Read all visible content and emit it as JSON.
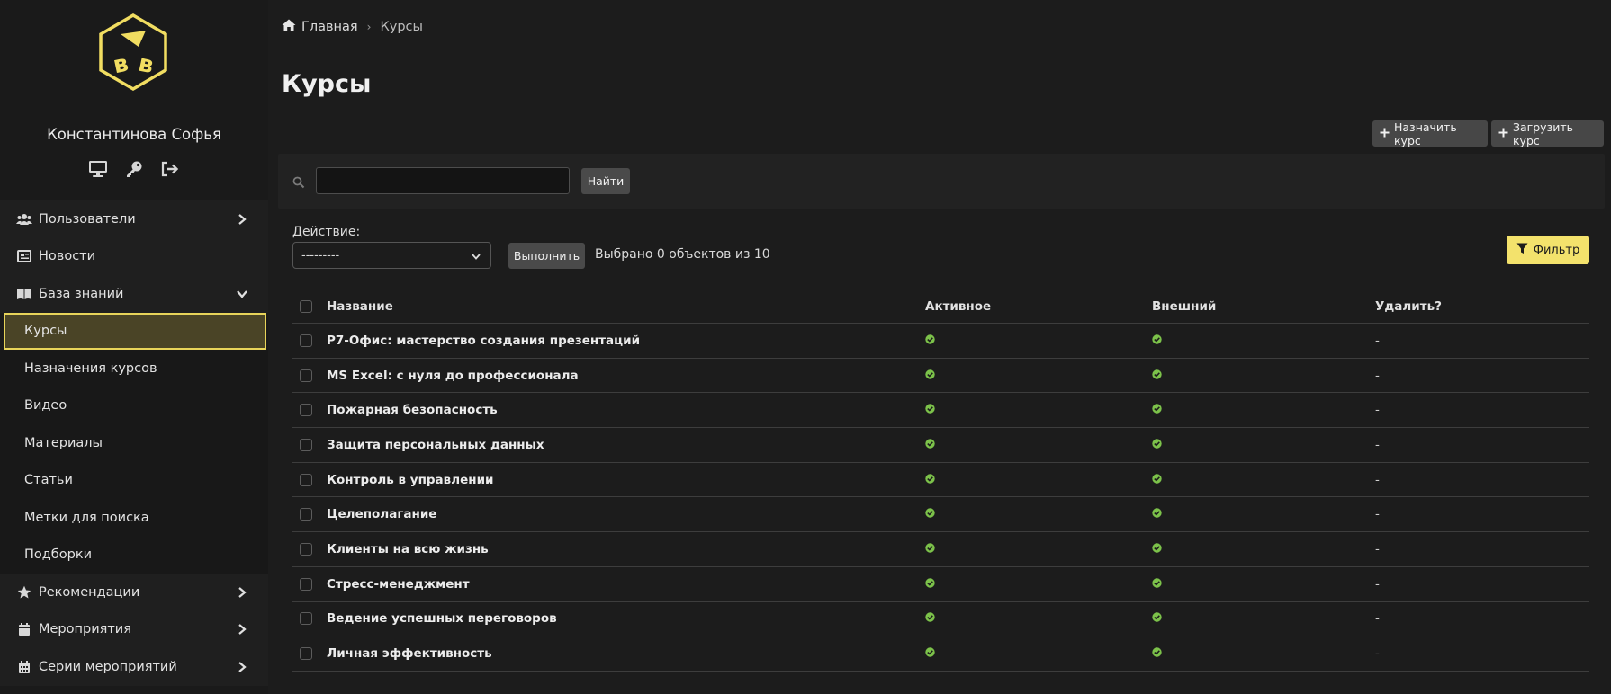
{
  "user": {
    "name": "Константинова Софья"
  },
  "user_icons": [
    "monitor-icon",
    "key-icon",
    "logout-icon"
  ],
  "nav": {
    "items": [
      {
        "label": "Пользователи",
        "icon": "users-icon",
        "chevron": "right"
      },
      {
        "label": "Новости",
        "icon": "newspaper-icon"
      },
      {
        "label": "База знаний",
        "icon": "book-icon",
        "chevron": "down"
      }
    ],
    "sub_items": [
      {
        "label": "Курсы",
        "active": true
      },
      {
        "label": "Назначения курсов"
      },
      {
        "label": "Видео"
      },
      {
        "label": "Материалы"
      },
      {
        "label": "Статьи"
      },
      {
        "label": "Метки для поиска"
      },
      {
        "label": "Подборки"
      }
    ],
    "bottom_items": [
      {
        "label": "Рекомендации",
        "icon": "star-icon",
        "chevron": "right"
      },
      {
        "label": "Мероприятия",
        "icon": "calendar-icon",
        "chevron": "right"
      },
      {
        "label": "Серии мероприятий",
        "icon": "calendar-grid-icon",
        "chevron": "right"
      }
    ]
  },
  "breadcrumb": {
    "home": "Главная",
    "current": "Курсы"
  },
  "page_title": "Курсы",
  "buttons": {
    "assign": "Назначить курс",
    "upload": "Загрузить курс",
    "search": "Найти",
    "run": "Выполнить",
    "filter": "Фильтр"
  },
  "search": {
    "value": "",
    "placeholder": ""
  },
  "action": {
    "label": "Действие:",
    "selected": "---------"
  },
  "counter": "Выбрано 0 объектов из 10",
  "table": {
    "headers": [
      "Название",
      "Активное",
      "Внешний",
      "Удалить?"
    ],
    "rows": [
      {
        "name": "Р7-Офис: мастерство создания презентаций",
        "active": true,
        "external": true,
        "delete": "-"
      },
      {
        "name": "MS Excel: с нуля до профессионала",
        "active": true,
        "external": true,
        "delete": "-"
      },
      {
        "name": "Пожарная безопасность",
        "active": true,
        "external": true,
        "delete": "-"
      },
      {
        "name": "Защита персональных данных",
        "active": true,
        "external": true,
        "delete": "-"
      },
      {
        "name": "Контроль в управлении",
        "active": true,
        "external": true,
        "delete": "-"
      },
      {
        "name": "Целеполагание",
        "active": true,
        "external": true,
        "delete": "-"
      },
      {
        "name": "Клиенты на всю жизнь",
        "active": true,
        "external": true,
        "delete": "-"
      },
      {
        "name": "Стресс-менеджмент",
        "active": true,
        "external": true,
        "delete": "-"
      },
      {
        "name": "Ведение успешных переговоров",
        "active": true,
        "external": true,
        "delete": "-"
      },
      {
        "name": "Личная эффективность",
        "active": true,
        "external": true,
        "delete": "-"
      }
    ]
  },
  "colors": {
    "accent": "#f3e26c",
    "active_border": "#e8d45a",
    "active_bg": "#4a4426",
    "check_green": "#7cc24a"
  }
}
